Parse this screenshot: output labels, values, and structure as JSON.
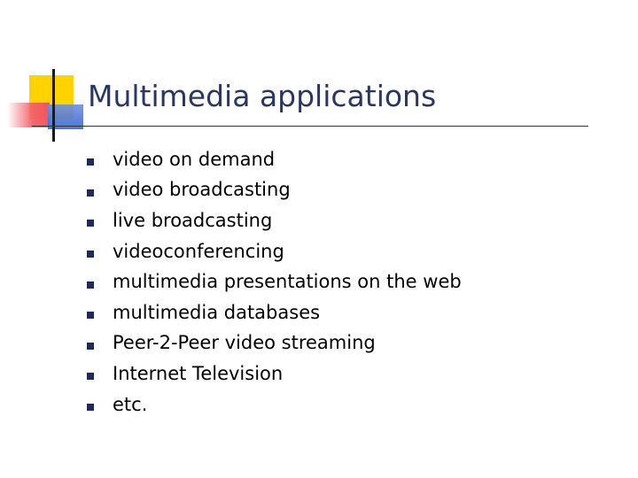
{
  "slide": {
    "title": "Multimedia applications",
    "bullets": [
      "video on demand",
      "video broadcasting",
      "live broadcasting",
      "videoconferencing",
      "multimedia presentations on the web",
      "multimedia databases",
      "Peer-2-Peer video streaming",
      "Internet Television",
      "etc."
    ]
  },
  "colors": {
    "title": "#2a3760",
    "bullet_marker": "#1e2a5a",
    "deco_yellow": "#ffd200",
    "deco_red": "#ef4f5c",
    "deco_blue": "#3f66d4"
  }
}
